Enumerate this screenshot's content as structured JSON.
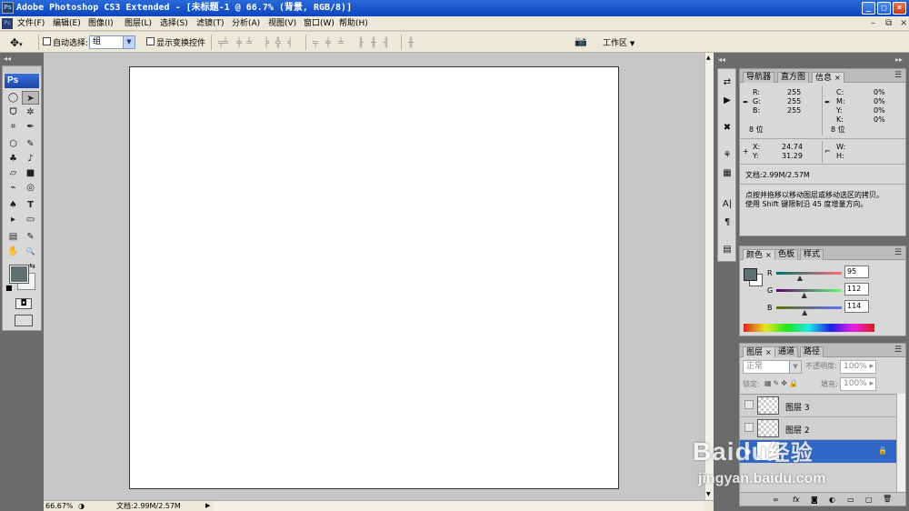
{
  "window": {
    "title": "Adobe Photoshop CS3 Extended - [未标题-1 @ 66.7% (背景, RGB/8)]",
    "ps_logo": "Ps",
    "btn_minimize": "_",
    "btn_maximize": "□",
    "btn_close": "×"
  },
  "menu": {
    "items": [
      "文件(F)",
      "编辑(E)",
      "图像(I)",
      "图层(L)",
      "选择(S)",
      "滤镜(T)",
      "分析(A)",
      "视图(V)",
      "窗口(W)",
      "帮助(H)"
    ],
    "doc_minimize": "–",
    "doc_restore": "⧉",
    "doc_close": "×"
  },
  "options": {
    "auto_select_label": "自动选择:",
    "auto_select_value": "组",
    "show_transform_label": "显示变换控件",
    "workspace_label": "工作区",
    "workspace_arrow": "▼",
    "dropdown_arrow": "▼"
  },
  "toolbox": {
    "logo": "Ps",
    "tools": [
      "◯",
      "➤",
      "ᗜ",
      "✲",
      "⌗",
      "✒",
      "⬡",
      "✎",
      "♣",
      "♪",
      "▱",
      "■",
      "⌁",
      "◎",
      "♠",
      "T",
      "▸",
      "▭",
      "▤",
      "✎",
      "✋",
      "🔍"
    ],
    "swap": "⇆",
    "quickmask": "◘",
    "screenmode": "▭"
  },
  "status": {
    "zoom": "66.67%",
    "doc": "文档:2.99M/2.57M",
    "arrow": "▶"
  },
  "dock_icons": [
    "⇄",
    "▶",
    "✖",
    "⚘",
    "▦",
    "A|",
    "¶",
    "▤"
  ],
  "info_panel": {
    "tabs": [
      "导航器",
      "直方图",
      "信息"
    ],
    "tab_close": "×",
    "r_label": "R:",
    "r_value": "255",
    "g_label": "G:",
    "g_value": "255",
    "b_label": "B:",
    "b_value": "255",
    "c_label": "C:",
    "c_value": "0%",
    "m_label": "M:",
    "m_value": "0%",
    "y_label": "Y:",
    "y_value": "0%",
    "k_label": "K:",
    "k_value": "0%",
    "bits_left": "8 位",
    "bits_right": "8 位",
    "x_label": "X:",
    "x_value": "24.74",
    "yc_label": "Y:",
    "yc_value": "31.29",
    "w_label": "W:",
    "h_label": "H:",
    "doc_size": "文档:2.99M/2.57M",
    "hint_line1": "点按并拖移以移动图层或移动选区的拷贝。",
    "hint_line2": "使用 Shift 键限制沿 45 度增量方向。"
  },
  "color_panel": {
    "tabs": [
      "颜色",
      "色板",
      "样式"
    ],
    "tab_close": "×",
    "r_label": "R",
    "r_value": "95",
    "g_label": "G",
    "g_value": "112",
    "b_label": "B",
    "b_value": "114",
    "r_level": 0.373,
    "g_level": 0.439,
    "b_level": 0.447,
    "swatch_color": "#5f7072"
  },
  "layers_panel": {
    "tabs": [
      "图层",
      "通道",
      "路径"
    ],
    "tab_close": "×",
    "blend_mode": "正常",
    "opacity_label": "不透明度:",
    "opacity_value": "100%",
    "lock_label": "锁定:",
    "fill_label": "填充:",
    "fill_value": "100%",
    "layers": [
      "图层 3",
      "图层 2",
      ""
    ],
    "footer_icons": [
      "∞",
      "fx",
      "◙",
      "◐",
      "▭",
      "▢",
      "🗑"
    ],
    "selected_color": "#3168c8"
  },
  "watermark": {
    "brand": "Baidu",
    "brand_cn": "经验",
    "url": "jingyan.baidu.com"
  }
}
